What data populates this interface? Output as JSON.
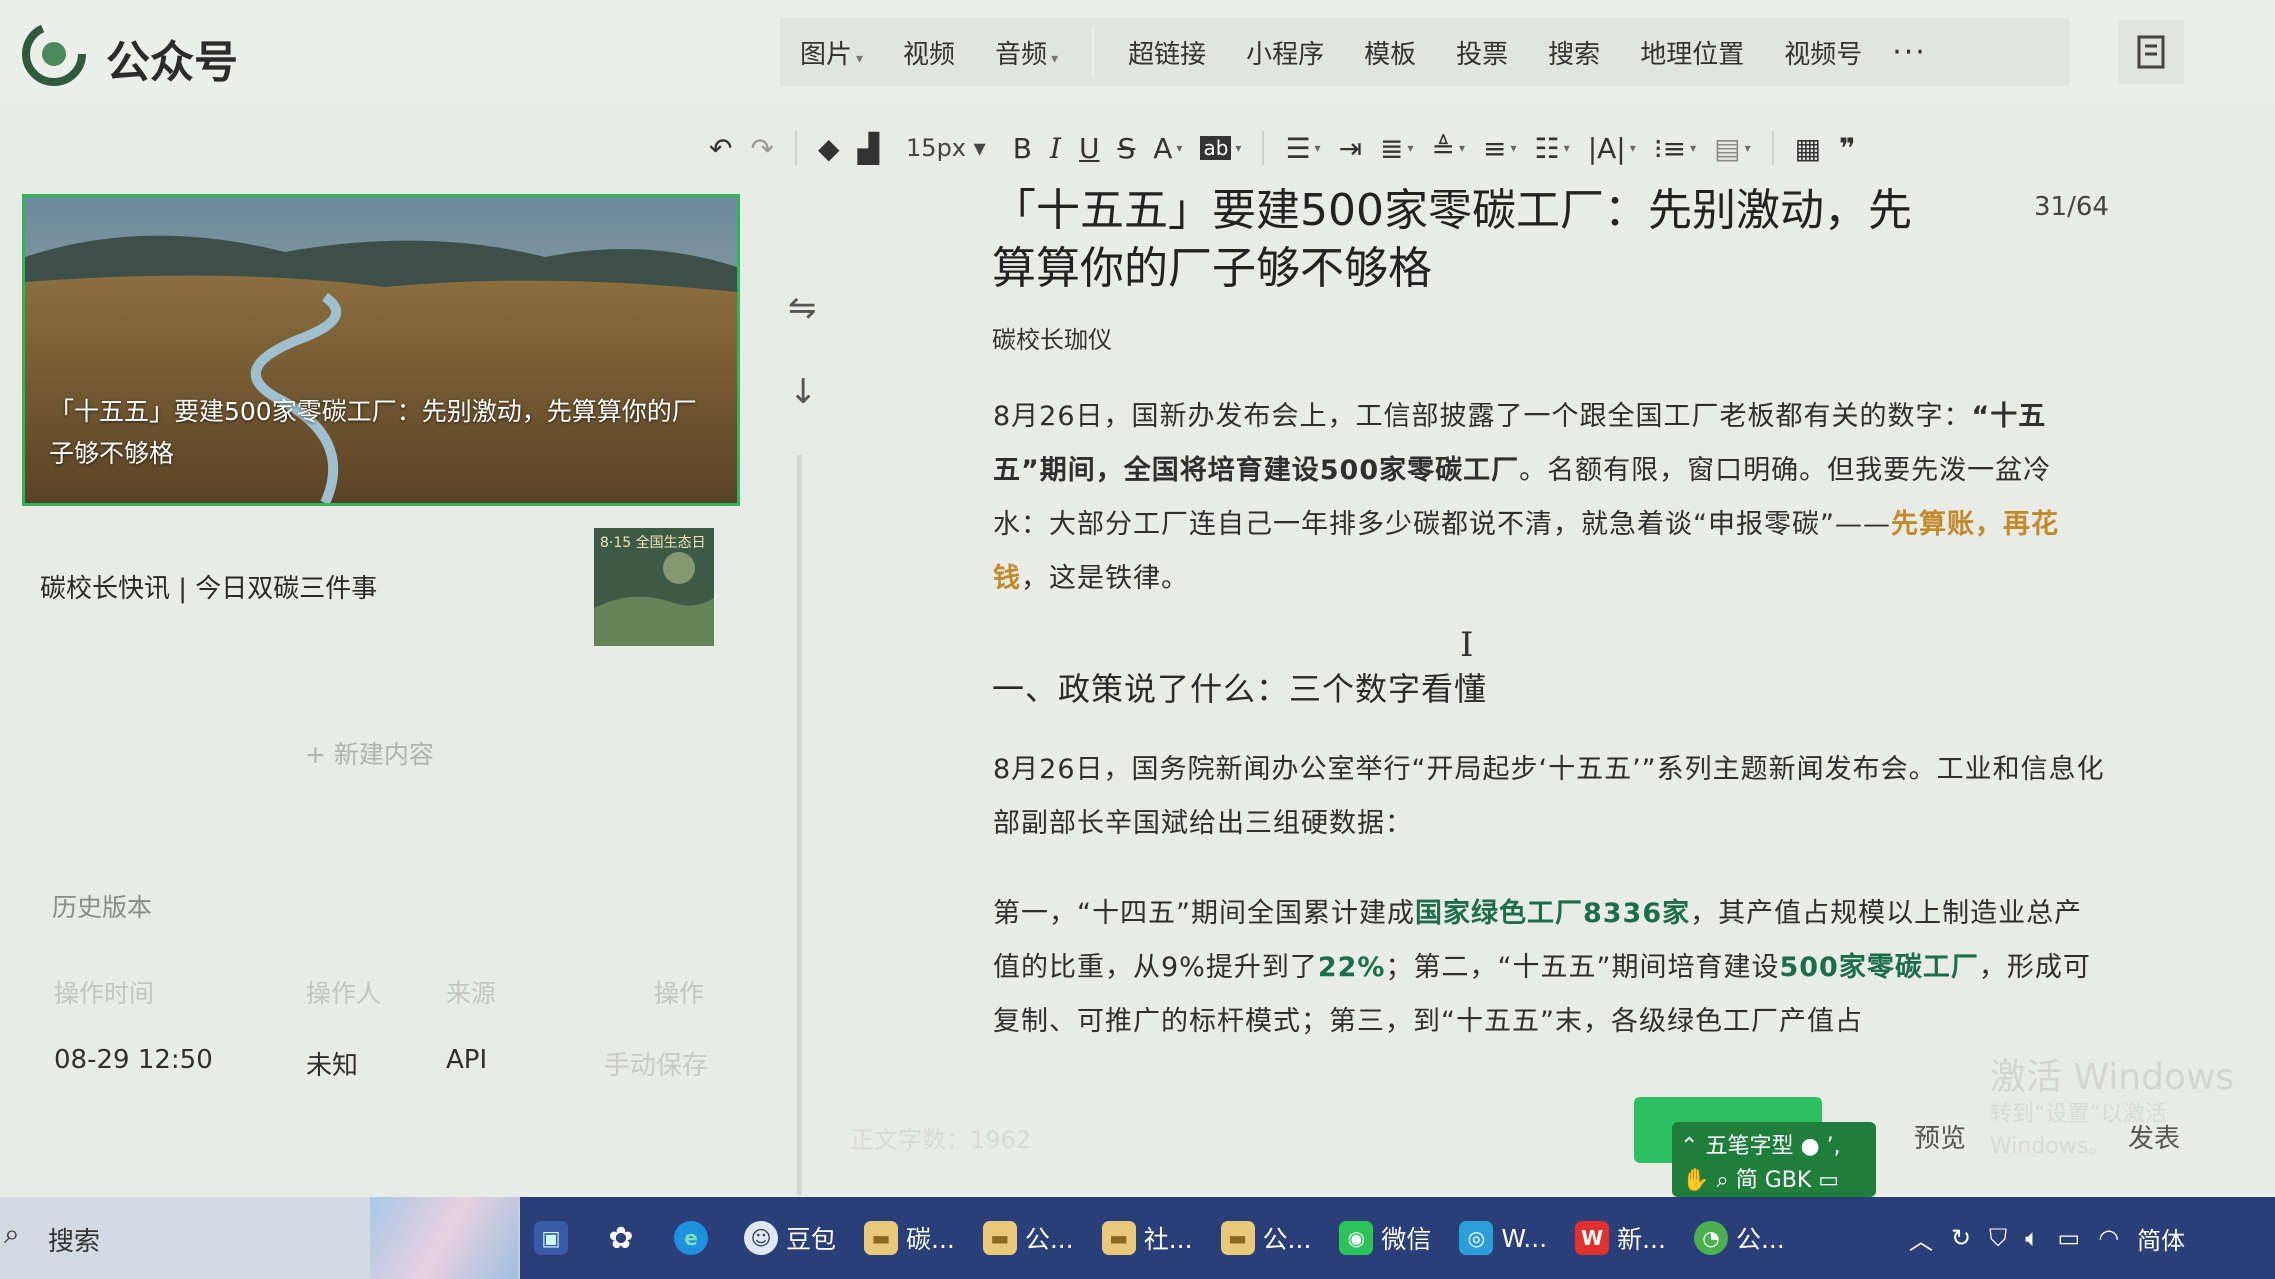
{
  "header": {
    "brand": "公众号"
  },
  "insert_bar": {
    "items": [
      "图片",
      "视频",
      "音频",
      "超链接",
      "小程序",
      "模板",
      "投票",
      "搜索",
      "地理位置",
      "视频号"
    ],
    "more": "···"
  },
  "format_bar": {
    "font_size": "15px",
    "icons": [
      "undo-icon",
      "redo-icon",
      "format-brush-icon",
      "clear-format-icon",
      "bold-icon",
      "italic-icon",
      "underline-icon",
      "strikethrough-icon",
      "font-color-icon",
      "highlight-icon",
      "align-icon",
      "indent-icon",
      "outdent-icon",
      "line-height-icon",
      "paragraph-spacing-icon",
      "letter-spacing-icon",
      "font-size-adjust-icon",
      "list-icon",
      "alignment-icon",
      "table-icon",
      "quote-icon"
    ],
    "letters": {
      "bold": "B",
      "italic": "I",
      "underline": "U",
      "strike": "S",
      "color": "A",
      "highlight": "ab"
    }
  },
  "left_panel": {
    "articles": [
      {
        "title": "「十五五」要建500家零碳工厂：先别激动，先算算你的厂子够不够格"
      },
      {
        "title": "碳校长快讯 | 今日双碳三件事",
        "thumb_text": "8·15 全国生态日"
      }
    ],
    "new_content": "+ 新建内容",
    "history": {
      "title": "历史版本",
      "headers": [
        "操作时间",
        "操作人",
        "来源",
        "操作"
      ],
      "rows": [
        {
          "time": "08-29 12:50",
          "operator": "未知",
          "source": "API",
          "action": "手动保存"
        }
      ]
    }
  },
  "editor": {
    "title": "「十五五」要建500家零碳工厂：先别激动，先算算你的厂子够不够格",
    "counter": "31/64",
    "author": "碳校长珈仪",
    "p1": {
      "a": "8月26日，国新办发布会上，工信部披露了一个跟全国工厂老板都有关的数字：",
      "b": "“十五五”期间，全国将培育建设500家零碳工厂",
      "c": "。名额有限，窗口明确。但我要先泼一盆冷水：大部分工厂连自己一年排多少碳都说不清，就急着谈“申报零碳”——",
      "d": "先算账，再花钱",
      "e": "，这是铁律。"
    },
    "section1": "一、政策说了什么：三个数字看懂",
    "p2": "8月26日，国务院新闻办公室举行“开局起步‘十五五’”系列主题新闻发布会。工业和信息化部副部长辛国斌给出三组硬数据：",
    "p3": {
      "a": "第一，“十四五”期间全国累计建成",
      "b": "国家绿色工厂8336家",
      "c": "，其产值占规模以上制造业总产值的比重，从9%提升到了",
      "d": "22%",
      "e": "；第二，“十五五”期间培育建设",
      "f": "500家零碳工厂",
      "g": "，形成可复制、可推广的标杆模式；第三，到“十五五”末，各级绿色工厂产值占"
    },
    "wordcount": "正文字数：1962",
    "watermark": "激活 Windows",
    "watermark_sub": "转到“设置”以激活 Windows。"
  },
  "actions": {
    "preview": "预览",
    "publish": "发表"
  },
  "ime": {
    "row1": "五笔字型",
    "row2": "简 GBK"
  },
  "taskbar": {
    "search": "搜索",
    "apps": [
      {
        "label": "",
        "icon": "files-icon"
      },
      {
        "label": "",
        "icon": "chatgpt-icon"
      },
      {
        "label": "",
        "icon": "edge-icon"
      },
      {
        "label": "豆包",
        "icon": "doubao-icon"
      },
      {
        "label": "碳...",
        "icon": "folder-icon"
      },
      {
        "label": "公...",
        "icon": "folder-icon"
      },
      {
        "label": "社...",
        "icon": "folder-icon"
      },
      {
        "label": "公...",
        "icon": "folder-icon"
      },
      {
        "label": "微信",
        "icon": "wechat-icon"
      },
      {
        "label": "W...",
        "icon": "wechat-work-icon"
      },
      {
        "label": "新...",
        "icon": "wps-icon"
      },
      {
        "label": "公...",
        "icon": "gzh-icon"
      }
    ],
    "tray_lang": "简体"
  },
  "colors": {
    "accent_green": "#2fbf63",
    "text_green": "#1c6e4a",
    "text_orange": "#c28a2a",
    "taskbar": "#2a3e78"
  }
}
